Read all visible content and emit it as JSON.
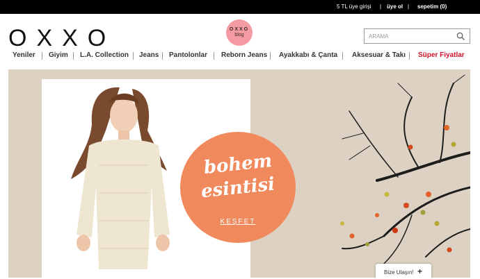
{
  "topbar": {
    "promo": "5 TL üye girişi",
    "sep1": "|",
    "register": "üye ol",
    "sep2": "|",
    "cart": "sepetim (0)"
  },
  "header": {
    "logo_text": "OXXO",
    "blog_badge_top": "OXXO",
    "blog_badge_bottom": "blog",
    "search_placeholder": "ARAMA"
  },
  "nav": {
    "items": [
      {
        "label": "Yeniler"
      },
      {
        "label": "Giyim"
      },
      {
        "label": "L.A. Collection"
      },
      {
        "label": "Jeans"
      },
      {
        "label": "Pantolonlar"
      },
      {
        "label": "Reborn Jeans"
      },
      {
        "label": "Ayakkabı & Çanta"
      },
      {
        "label": "Aksesuar & Takı"
      },
      {
        "label": "Süper Fiyatlar"
      }
    ],
    "separator": "|",
    "sale_color": "#d0112b"
  },
  "hero": {
    "headline_1": "bohem",
    "headline_2": "esintisi",
    "cta": "KEŞFET",
    "accent_color": "#f08a5d",
    "background_color": "#dcd1c3"
  },
  "contact_widget": {
    "label": "Bize Ulaşın!",
    "icon": "plus-icon"
  }
}
